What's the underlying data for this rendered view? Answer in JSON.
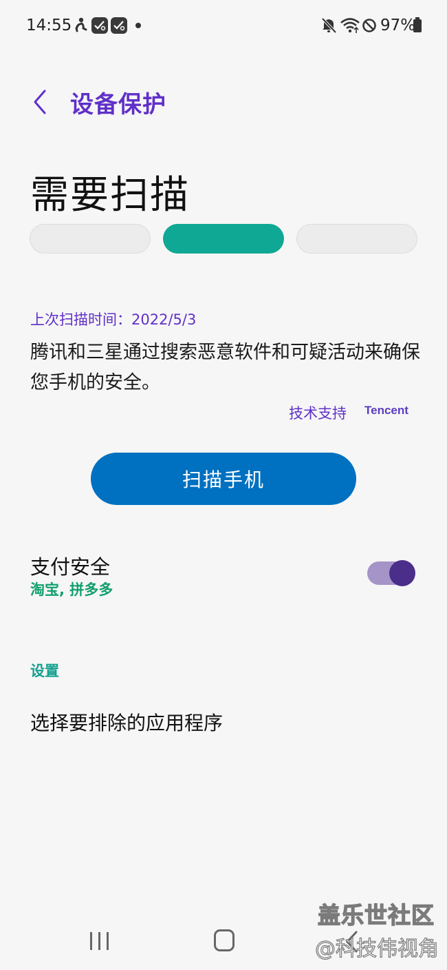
{
  "status_bar": {
    "time": "14:55",
    "battery": "97%",
    "notification_icons": [
      "person-run-icon",
      "check-badge-icon",
      "check-badge-icon"
    ],
    "system_icons": [
      "mute-icon",
      "wifi-icon",
      "dnd-icon",
      "battery-icon"
    ]
  },
  "header": {
    "title": "设备保护",
    "back_icon": "chevron-left-icon"
  },
  "status": {
    "heading": "需要扫描",
    "progress": {
      "segments": 3,
      "active_segment": 2,
      "active_color": "#0fa894"
    }
  },
  "scan_info": {
    "last_scan": "上次扫描时间：2022/5/3",
    "description": "腾讯和三星通过搜索恶意软件和可疑活动来确保您手机的安全。",
    "support_label": "技术支持",
    "provider_logo": "Tencent"
  },
  "scan_button": {
    "label": "扫描手机",
    "color": "#0070c0"
  },
  "payment_security": {
    "title": "支付安全",
    "apps": "淘宝, 拼多多",
    "enabled": true
  },
  "settings": {
    "header": "设置",
    "exclude_apps": "选择要排除的应用程序"
  },
  "navigation": {
    "icons": [
      "recent-apps-icon",
      "home-icon",
      "back-icon"
    ]
  },
  "watermark": {
    "line1": "盖乐世社区",
    "line2": "@科技伟视角"
  },
  "colors": {
    "accent_purple": "#6030c8",
    "teal": "#0fa894",
    "button_blue": "#0070c0",
    "toggle_on": "#4b2e8a",
    "green_text": "#12a06e"
  }
}
